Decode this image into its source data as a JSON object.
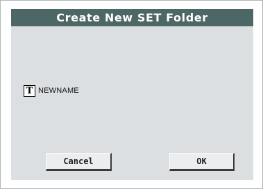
{
  "dialog": {
    "title": "Create New SET Folder",
    "name_field": {
      "icon": "T",
      "icon_name": "text-edit-icon",
      "value": "NEWNAME"
    },
    "buttons": {
      "cancel": "Cancel",
      "ok": "OK"
    }
  },
  "colors": {
    "title_bar": "#4d6666",
    "body_background": "#dcdfe1",
    "button_face": "#ecedee"
  }
}
